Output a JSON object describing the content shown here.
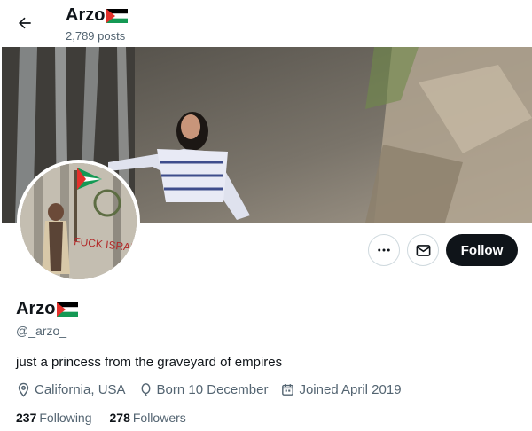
{
  "header": {
    "name": "Arzo",
    "posts": "2,789 posts"
  },
  "profile": {
    "name": "Arzo",
    "handle": "@_arzo_",
    "bio": "just a princess from the graveyard of empires",
    "location": "California, USA",
    "birthday": "Born 10 December",
    "joined": "Joined April 2019",
    "following_count": "237",
    "following_label": "Following",
    "followers_count": "278",
    "followers_label": "Followers"
  },
  "actions": {
    "follow_label": "Follow"
  },
  "avatar_text": "FUCK ISRAEL",
  "colors": {
    "primary_text": "#0f1419",
    "secondary_text": "#536471",
    "border": "#cfd9de",
    "follow_bg": "#0f1419"
  }
}
